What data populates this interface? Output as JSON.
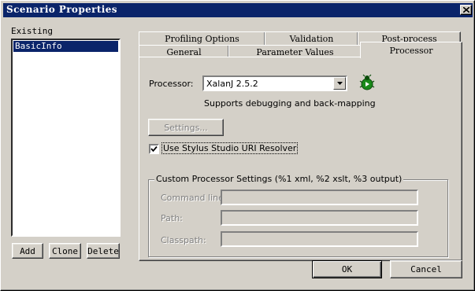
{
  "window": {
    "title": "Scenario Properties"
  },
  "left": {
    "existing_label": "Existing",
    "items": [
      "BasicInfo"
    ],
    "add_label": "Add",
    "clone_label": "Clone",
    "delete_label": "Delete"
  },
  "tabs": {
    "row_back": [
      "Profiling Options",
      "Validation",
      "Post-process"
    ],
    "row_front": [
      "General",
      "Parameter Values",
      "Processor"
    ],
    "active": "Processor"
  },
  "processor": {
    "label": "Processor:",
    "selected": "XalanJ 2.5.2",
    "support_text": "Supports debugging and back-mapping",
    "settings_label": "Settings...",
    "uri_resolver_label": "Use Stylus Studio URI Resolver",
    "uri_resolver_checked": true
  },
  "custom": {
    "group_title": "Custom Processor Settings (%1 xml, %2 xslt, %3 output)",
    "command_label": "Command line:",
    "path_label": "Path:",
    "classpath_label": "Classpath:",
    "command_value": "",
    "path_value": "",
    "classpath_value": ""
  },
  "footer": {
    "ok_label": "OK",
    "cancel_label": "Cancel"
  }
}
